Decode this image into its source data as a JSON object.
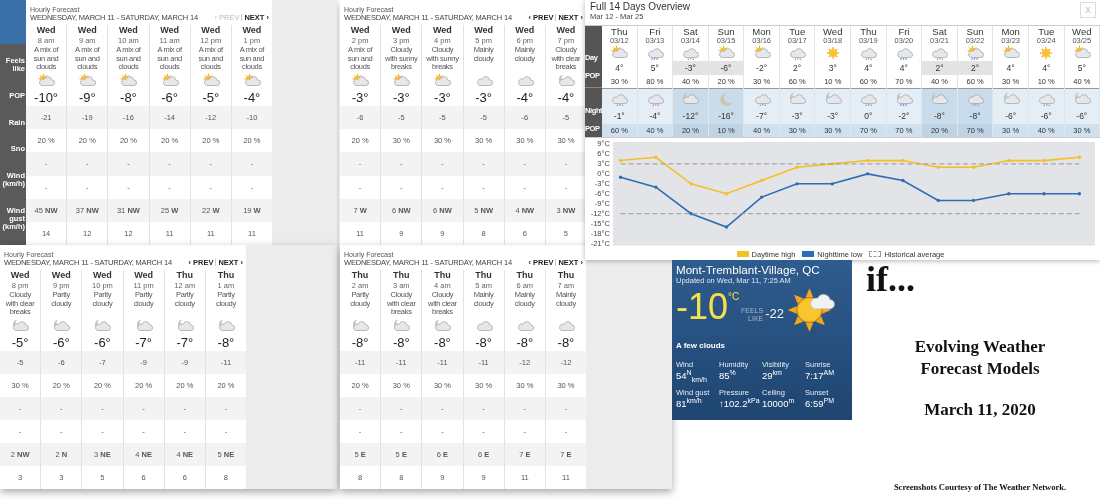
{
  "hourly_panels": [
    {
      "title": "Hourly Forecast",
      "range": "WEDNESDAY, MARCH 11 - SATURDAY, MARCH 14",
      "prev": {
        "label": "‹ PREV",
        "disabled": true
      },
      "next": "NEXT ›",
      "row_labels": [
        "Feels like",
        "POP",
        "Rain",
        "Sno",
        "Wind (km/h)",
        "Wind gust (km/h)"
      ],
      "columns": [
        {
          "day": "Wed",
          "time": "8 am",
          "condition": "A mix of sun and clouds",
          "kind": "sun-cloud",
          "temp": "-10°",
          "feels": "-21",
          "pop": "20 %",
          "rain": "-",
          "snow": "-",
          "wind": "45 **NW**",
          "gust": "14"
        },
        {
          "day": "Wed",
          "time": "9 am",
          "condition": "A mix of sun and clouds",
          "kind": "sun-cloud",
          "temp": "-9°",
          "feels": "-19",
          "pop": "20 %",
          "rain": "-",
          "snow": "-",
          "wind": "37 **NW**",
          "gust": "12"
        },
        {
          "day": "Wed",
          "time": "10 am",
          "condition": "A mix of sun and clouds",
          "kind": "sun-cloud",
          "temp": "-8°",
          "feels": "-16",
          "pop": "20 %",
          "rain": "-",
          "snow": "-",
          "wind": "31 **NW**",
          "gust": "12"
        },
        {
          "day": "Wed",
          "time": "11 am",
          "condition": "A mix of sun and clouds",
          "kind": "sun-cloud",
          "temp": "-6°",
          "feels": "-14",
          "pop": "20 %",
          "rain": "-",
          "snow": "-",
          "wind": "25 **W**",
          "gust": "11"
        },
        {
          "day": "Wed",
          "time": "12 pm",
          "condition": "A mix of sun and clouds",
          "kind": "sun-cloud",
          "temp": "-5°",
          "feels": "-12",
          "pop": "20 %",
          "rain": "-",
          "snow": "-",
          "wind": "22 **W**",
          "gust": "11"
        },
        {
          "day": "Wed",
          "time": "1 pm",
          "condition": "A mix of sun and clouds",
          "kind": "sun-cloud",
          "temp": "-4°",
          "feels": "-10",
          "pop": "20 %",
          "rain": "-",
          "snow": "-",
          "wind": "19 **W**",
          "gust": "11"
        }
      ]
    },
    {
      "title": "Hourly Forecast",
      "range": "WEDNESDAY, MARCH 11 - SATURDAY, MARCH 14",
      "prev": {
        "label": "‹ PREV",
        "disabled": false
      },
      "next": "NEXT ›",
      "columns": [
        {
          "day": "Wed",
          "time": "2 pm",
          "condition": "A mix of sun and clouds",
          "kind": "sun-cloud",
          "temp": "-3°",
          "feels": "-6",
          "pop": "20 %",
          "rain": "-",
          "snow": "-",
          "wind": "7 **W**",
          "gust": "11"
        },
        {
          "day": "Wed",
          "time": "3 pm",
          "condition": "Cloudy with sunny breaks",
          "kind": "sun-cloud",
          "temp": "-3°",
          "feels": "-5",
          "pop": "30 %",
          "rain": "-",
          "snow": "-",
          "wind": "6 **NW**",
          "gust": "9"
        },
        {
          "day": "Wed",
          "time": "4 pm",
          "condition": "Cloudy with sunny breaks",
          "kind": "sun-cloud",
          "temp": "-3°",
          "feels": "-5",
          "pop": "30 %",
          "rain": "-",
          "snow": "-",
          "wind": "6 **NW**",
          "gust": "9"
        },
        {
          "day": "Wed",
          "time": "5 pm",
          "condition": "Mainly cloudy",
          "kind": "cloud",
          "temp": "-3°",
          "feels": "-5",
          "pop": "30 %",
          "rain": "-",
          "snow": "-",
          "wind": "5 **NW**",
          "gust": "8"
        },
        {
          "day": "Wed",
          "time": "6 pm",
          "condition": "Mainly cloudy",
          "kind": "cloud",
          "temp": "-4°",
          "feels": "-6",
          "pop": "30 %",
          "rain": "-",
          "snow": "-",
          "wind": "4 **NW**",
          "gust": "6"
        },
        {
          "day": "Wed",
          "time": "7 pm",
          "condition": "Cloudy with clear breaks",
          "kind": "moon-cloud",
          "temp": "-4°",
          "feels": "-5",
          "pop": "30 %",
          "rain": "-",
          "snow": "-",
          "wind": "3 **NW**",
          "gust": "5"
        }
      ]
    },
    {
      "title": "Hourly Forecast",
      "range": "WEDNESDAY, MARCH 11 - SATURDAY, MARCH 14",
      "prev": {
        "label": "‹ PREV",
        "disabled": false
      },
      "next": "NEXT ›",
      "columns": [
        {
          "day": "Wed",
          "time": "8 pm",
          "condition": "Cloudy with clear breaks",
          "kind": "moon-cloud",
          "temp": "-5°",
          "feels": "-5",
          "pop": "30 %",
          "rain": "-",
          "snow": "-",
          "wind": "2 **NW**",
          "gust": "3"
        },
        {
          "day": "Wed",
          "time": "9 pm",
          "condition": "Partly cloudy",
          "kind": "moon-cloud",
          "temp": "-6°",
          "feels": "-6",
          "pop": "20 %",
          "rain": "-",
          "snow": "-",
          "wind": "2 **N**",
          "gust": "3"
        },
        {
          "day": "Wed",
          "time": "10 pm",
          "condition": "Partly cloudy",
          "kind": "moon-cloud",
          "temp": "-6°",
          "feels": "-7",
          "pop": "20 %",
          "rain": "-",
          "snow": "-",
          "wind": "3 **NE**",
          "gust": "5"
        },
        {
          "day": "Wed",
          "time": "11 pm",
          "condition": "Partly cloudy",
          "kind": "moon-cloud",
          "temp": "-7°",
          "feels": "-9",
          "pop": "20 %",
          "rain": "-",
          "snow": "-",
          "wind": "4 **NE**",
          "gust": "6"
        },
        {
          "day": "Thu",
          "time": "12 am",
          "condition": "Partly cloudy",
          "kind": "moon-cloud",
          "temp": "-7°",
          "feels": "-9",
          "pop": "20 %",
          "rain": "-",
          "snow": "-",
          "wind": "4 **NE**",
          "gust": "6"
        },
        {
          "day": "Thu",
          "time": "1 am",
          "condition": "Partly cloudy",
          "kind": "moon-cloud",
          "temp": "-8°",
          "feels": "-11",
          "pop": "20 %",
          "rain": "-",
          "snow": "-",
          "wind": "5 **NE**",
          "gust": "8"
        }
      ]
    },
    {
      "title": "Hourly Forecast",
      "range": "WEDNESDAY, MARCH 11 - SATURDAY, MARCH 14",
      "prev": {
        "label": "‹ PREV",
        "disabled": false
      },
      "next": "NEXT ›",
      "columns": [
        {
          "day": "Thu",
          "time": "2 am",
          "condition": "Partly cloudy",
          "kind": "moon-cloud",
          "temp": "-8°",
          "feels": "-11",
          "pop": "20 %",
          "rain": "-",
          "snow": "-",
          "wind": "5 **E**",
          "gust": "8"
        },
        {
          "day": "Thu",
          "time": "3 am",
          "condition": "Cloudy with clear breaks",
          "kind": "moon-cloud",
          "temp": "-8°",
          "feels": "-11",
          "pop": "30 %",
          "rain": "-",
          "snow": "-",
          "wind": "5 **E**",
          "gust": "8"
        },
        {
          "day": "Thu",
          "time": "4 am",
          "condition": "Cloudy with clear breaks",
          "kind": "moon-cloud",
          "temp": "-8°",
          "feels": "-11",
          "pop": "30 %",
          "rain": "-",
          "snow": "-",
          "wind": "6 **E**",
          "gust": "9"
        },
        {
          "day": "Thu",
          "time": "5 am",
          "condition": "Mainly cloudy",
          "kind": "cloud",
          "temp": "-8°",
          "feels": "-11",
          "pop": "30 %",
          "rain": "-",
          "snow": "-",
          "wind": "6 **E**",
          "gust": "9"
        },
        {
          "day": "Thu",
          "time": "6 am",
          "condition": "Mainly cloudy",
          "kind": "cloud",
          "temp": "-8°",
          "feels": "-12",
          "pop": "30 %",
          "rain": "-",
          "snow": "-",
          "wind": "7 **E**",
          "gust": "11"
        },
        {
          "day": "Thu",
          "time": "7 am",
          "condition": "Mainly cloudy",
          "kind": "cloud",
          "temp": "-8°",
          "feels": "-12",
          "pop": "30 %",
          "rain": "-",
          "snow": "-",
          "wind": "7 **E**",
          "gust": "11"
        }
      ]
    }
  ],
  "overview": {
    "title": "Full 14 Days Overview",
    "range": "Mar 12 - Mar 25",
    "close": "X",
    "row_labels": {
      "day": "Day",
      "day_pop": "POP",
      "night": "Night",
      "night_pop": "POP"
    },
    "days": [
      {
        "day": "Thu",
        "date": "03/12",
        "shaded": false,
        "daytime": {
          "kind": "sun-cloud",
          "temp": "4°",
          "pop": "30 %"
        },
        "night": {
          "kind": "cloud-snow",
          "temp": "-1°",
          "pop": "60 %"
        }
      },
      {
        "day": "Fri",
        "date": "03/13",
        "shaded": false,
        "daytime": {
          "kind": "rain",
          "temp": "5°",
          "pop": "80 %"
        },
        "night": {
          "kind": "cloud-snow",
          "temp": "-4°",
          "pop": "40 %"
        }
      },
      {
        "day": "Sat",
        "date": "03/14",
        "shaded": true,
        "daytime": {
          "kind": "cloud-snow",
          "temp": "-3°",
          "pop": "40 %"
        },
        "night": {
          "kind": "moon-cloud",
          "temp": "-12°",
          "pop": "20 %"
        }
      },
      {
        "day": "Sun",
        "date": "03/15",
        "shaded": true,
        "daytime": {
          "kind": "sun-cloud",
          "temp": "-6°",
          "pop": "20 %"
        },
        "night": {
          "kind": "moon",
          "temp": "-16°",
          "pop": "10 %"
        }
      },
      {
        "day": "Mon",
        "date": "03/16",
        "shaded": false,
        "daytime": {
          "kind": "sun-cloud",
          "temp": "-2°",
          "pop": "30 %"
        },
        "night": {
          "kind": "cloud-snow",
          "temp": "-7°",
          "pop": "40 %"
        }
      },
      {
        "day": "Tue",
        "date": "03/17",
        "shaded": false,
        "daytime": {
          "kind": "cloud-snow",
          "temp": "2°",
          "pop": "60 %"
        },
        "night": {
          "kind": "moon-cloud",
          "temp": "-3°",
          "pop": "30 %"
        }
      },
      {
        "day": "Wed",
        "date": "03/18",
        "shaded": false,
        "daytime": {
          "kind": "sun",
          "temp": "3°",
          "pop": "10 %"
        },
        "night": {
          "kind": "moon-cloud",
          "temp": "-3°",
          "pop": "30 %"
        }
      },
      {
        "day": "Thu",
        "date": "03/19",
        "shaded": false,
        "daytime": {
          "kind": "cloud-snow",
          "temp": "4°",
          "pop": "60 %"
        },
        "night": {
          "kind": "cloud-snow",
          "temp": "0°",
          "pop": "70 %"
        }
      },
      {
        "day": "Fri",
        "date": "03/20",
        "shaded": false,
        "daytime": {
          "kind": "rain",
          "temp": "4°",
          "pop": "70 %"
        },
        "night": {
          "kind": "moon-rain",
          "temp": "-2°",
          "pop": "70 %"
        }
      },
      {
        "day": "Sat",
        "date": "03/21",
        "shaded": true,
        "daytime": {
          "kind": "cloud-snow",
          "temp": "2°",
          "pop": "40 %"
        },
        "night": {
          "kind": "moon-cloud",
          "temp": "-8°",
          "pop": "20 %"
        }
      },
      {
        "day": "Sun",
        "date": "03/22",
        "shaded": true,
        "daytime": {
          "kind": "sun-rain",
          "temp": "2°",
          "pop": "60 %"
        },
        "night": {
          "kind": "cloud-snow",
          "temp": "-8°",
          "pop": "70 %"
        }
      },
      {
        "day": "Mon",
        "date": "03/23",
        "shaded": false,
        "daytime": {
          "kind": "sun-cloud",
          "temp": "4°",
          "pop": "30 %"
        },
        "night": {
          "kind": "moon-cloud",
          "temp": "-6°",
          "pop": "30 %"
        }
      },
      {
        "day": "Tue",
        "date": "03/24",
        "shaded": false,
        "daytime": {
          "kind": "sun",
          "temp": "4°",
          "pop": "10 %"
        },
        "night": {
          "kind": "cloud-snow",
          "temp": "-6°",
          "pop": "40 %"
        }
      },
      {
        "day": "Wed",
        "date": "03/25",
        "shaded": false,
        "daytime": {
          "kind": "sun-cloud",
          "temp": "5°",
          "pop": "40 %"
        },
        "night": {
          "kind": "moon-cloud",
          "temp": "-6°",
          "pop": "30 %"
        }
      }
    ],
    "chart_data": {
      "type": "line",
      "ylim": [
        -21,
        9
      ],
      "yticks": [
        {
          "value": 9,
          "label": "9°C"
        },
        {
          "value": 6,
          "label": "6°C"
        },
        {
          "value": 3,
          "label": "3°C"
        },
        {
          "value": 0,
          "label": "0°C"
        },
        {
          "value": -3,
          "label": "-3°C"
        },
        {
          "value": -6,
          "label": "-6°C"
        },
        {
          "value": -9,
          "label": "-9°C"
        },
        {
          "value": -12,
          "label": "-12°C"
        },
        {
          "value": -15,
          "label": "-15°C"
        },
        {
          "value": -18,
          "label": "-18°C"
        },
        {
          "value": -21,
          "label": "-21°C"
        }
      ],
      "series": [
        {
          "name": "Daytime high",
          "color": "#f5bf26",
          "values": [
            4,
            5,
            -3,
            -6,
            -2,
            2,
            3,
            4,
            4,
            2,
            2,
            4,
            4,
            5
          ]
        },
        {
          "name": "Nighttime low",
          "color": "#2e6db4",
          "values": [
            -1,
            -4,
            -12,
            -16,
            -7,
            -3,
            -3,
            0,
            -2,
            -8,
            -8,
            -6,
            -6,
            -6
          ]
        },
        {
          "name": "Historical average",
          "color": "#999999",
          "line_style": "dashed",
          "values": [
            3,
            3,
            3,
            3,
            3,
            3,
            3,
            3,
            3,
            3,
            3,
            3,
            3,
            3
          ]
        },
        {
          "color": "#999999",
          "line_style": "dashed",
          "values": [
            -12,
            -12,
            -12,
            -12,
            -12,
            -12,
            -12,
            -12,
            -12,
            -12,
            -12,
            -12,
            -12,
            -12
          ]
        }
      ]
    }
  },
  "current": {
    "location": "Mont-Tremblant-Village, QC",
    "updated": "Updated on Wed, Mar 11, 7:25 AM",
    "temp": "-10",
    "unit": "°C",
    "feels_label": "FEELS LIKE",
    "feels": "-22",
    "condition": "A few clouds",
    "stats": [
      {
        "label": "Wind",
        "value": "54$^{N}$$_{km/h}$"
      },
      {
        "label": "Humidity",
        "value": "85$^{%}$"
      },
      {
        "label": "Visibility",
        "value": "29$^{km}$"
      },
      {
        "label": "Sunrise",
        "value": "7:17$^{AM}$"
      },
      {
        "label": "Wind gust",
        "value": "81$^{km/h}$"
      },
      {
        "label": "Pressure",
        "value": "↑102.2$^{kPa}$"
      },
      {
        "label": "Ceiling",
        "value": "10000$^{m}$"
      },
      {
        "label": "Sunset",
        "value": "6:59$^{PM}$"
      }
    ]
  },
  "slide": {
    "teaser": "if...",
    "title": "Evolving Weather Forecast Models",
    "date": "March 11, 2020",
    "credit": "Screenshots Courtesy of The Weather Network."
  }
}
